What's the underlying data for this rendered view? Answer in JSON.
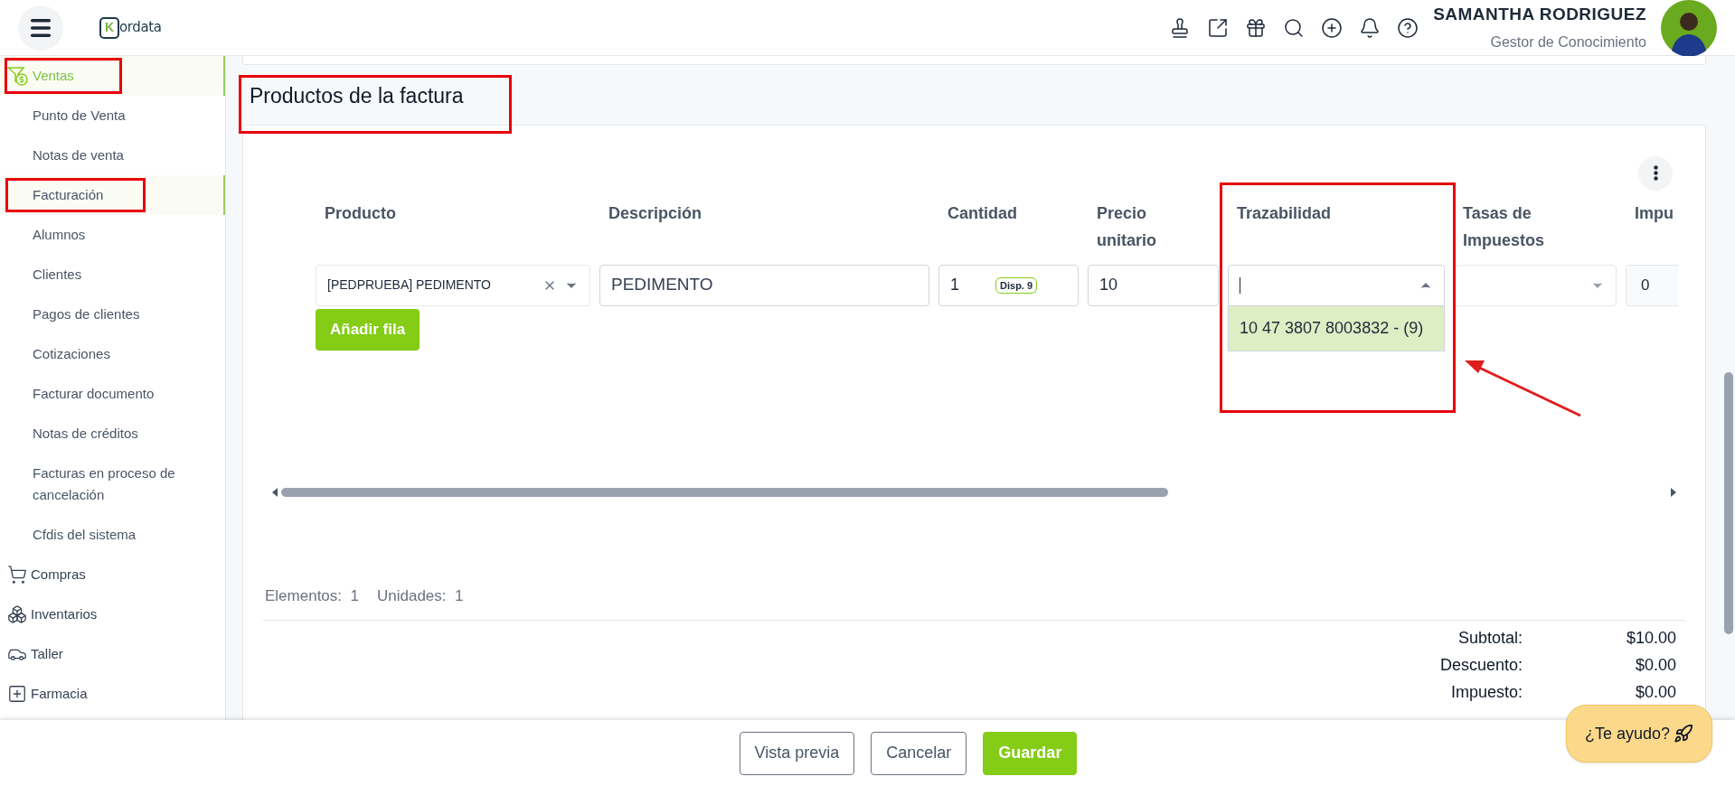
{
  "header": {
    "logo": {
      "mark": "K",
      "text": "ordata"
    },
    "user": {
      "name": "SAMANTHA RODRIGUEZ",
      "role": "Gestor de Conocimiento"
    }
  },
  "sidebar": {
    "sections": [
      {
        "label": "Ventas",
        "selected": true,
        "children": [
          {
            "label": "Punto de Venta",
            "selected": false
          },
          {
            "label": "Notas de venta",
            "selected": false
          },
          {
            "label": "Facturación",
            "selected": true
          },
          {
            "label": "Alumnos",
            "selected": false
          },
          {
            "label": "Clientes",
            "selected": false
          },
          {
            "label": "Pagos de clientes",
            "selected": false
          },
          {
            "label": "Cotizaciones",
            "selected": false
          },
          {
            "label": "Facturar documento",
            "selected": false
          },
          {
            "label": "Notas de créditos",
            "selected": false
          },
          {
            "label": "Facturas en proceso de cancelación",
            "selected": false
          },
          {
            "label": "Cfdis del sistema",
            "selected": false
          }
        ]
      },
      {
        "label": "Compras",
        "selected": false
      },
      {
        "label": "Inventarios",
        "selected": false
      },
      {
        "label": "Taller",
        "selected": false
      },
      {
        "label": "Farmacia",
        "selected": false
      }
    ]
  },
  "page": {
    "title": "Productos de la factura"
  },
  "table": {
    "columns": [
      "Producto",
      "Descripción",
      "Cantidad",
      "Precio unitario",
      "Trazabilidad",
      "Tasas de Impuestos",
      "Impu"
    ],
    "rows": [
      {
        "product": "[PEDPRUEBA] PEDIMENTO",
        "description": "PEDIMENTO",
        "quantity": "1",
        "available": "Disp. 9",
        "unit_price": "10",
        "traceability": {
          "expanded": true,
          "options": [
            "10 47 3807 8003832 - (9)"
          ]
        },
        "tax": "0"
      }
    ],
    "add_row": "Añadir fila"
  },
  "summary": {
    "counts": [
      {
        "label": "Elementos:",
        "value": "1"
      },
      {
        "label": "Unidades:",
        "value": "1"
      }
    ],
    "totals": [
      {
        "label": "Subtotal:",
        "value": "$10.00"
      },
      {
        "label": "Descuento:",
        "value": "$0.00"
      },
      {
        "label": "Impuesto:",
        "value": "$0.00"
      }
    ]
  },
  "footer": {
    "buttons": [
      {
        "label": "Vista previa",
        "kind": "outline"
      },
      {
        "label": "Cancelar",
        "kind": "outline"
      },
      {
        "label": "Guardar",
        "kind": "primary"
      }
    ]
  },
  "help": {
    "label": "¿Te ayudo?"
  }
}
